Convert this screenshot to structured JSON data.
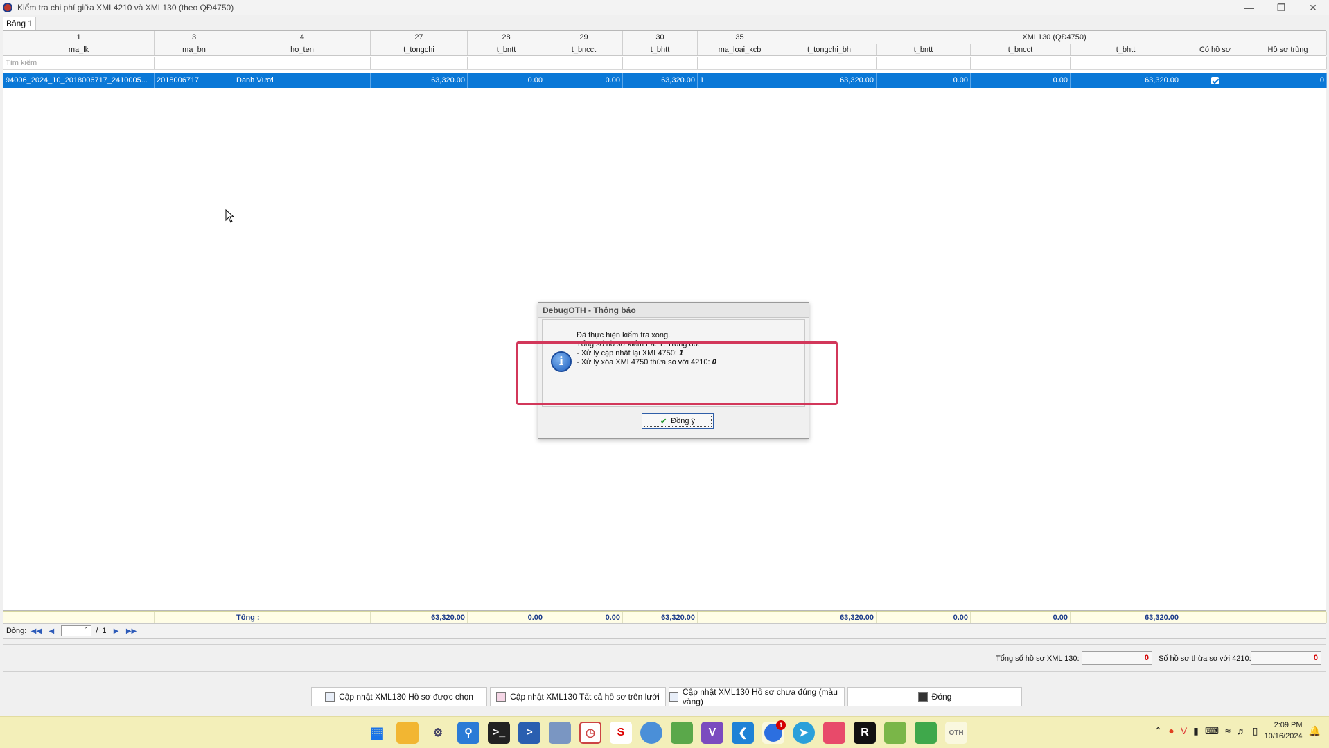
{
  "window": {
    "title": "Kiểm tra chi phí giữa XML4210 và XML130 (theo QĐ4750)",
    "tab": "Bảng 1"
  },
  "grid": {
    "group_headers": [
      "1",
      "3",
      "4",
      "27",
      "28",
      "29",
      "30",
      "35",
      "XML130 (QĐ4750)"
    ],
    "columns": [
      "ma_lk",
      "ma_bn",
      "ho_ten",
      "t_tongchi",
      "t_bntt",
      "t_bncct",
      "t_bhtt",
      "ma_loai_kcb",
      "t_tongchi_bh",
      "t_bntt",
      "t_bncct",
      "t_bhtt",
      "Có hồ sơ",
      "Hồ sơ trùng"
    ],
    "search_placeholder": "Tìm kiếm",
    "rows": [
      {
        "ma_lk": "94006_2024_10_2018006717_2410005...",
        "ma_bn": "2018006717",
        "ho_ten": "Danh Vươl",
        "t_tongchi": "63,320.00",
        "t_bntt": "0.00",
        "t_bncct": "0.00",
        "t_bhtt": "63,320.00",
        "ma_loai_kcb": "1",
        "t_tongchi_bh": "63,320.00",
        "t_bntt_130": "0.00",
        "t_bncct_130": "0.00",
        "t_bhtt_130": "63,320.00",
        "co_ho_so": true,
        "ho_so_trung": "0"
      }
    ],
    "totals": {
      "label": "Tổng :",
      "t_tongchi": "63,320.00",
      "t_bntt": "0.00",
      "t_bncct": "0.00",
      "t_bhtt": "63,320.00",
      "t_tongchi_bh": "63,320.00",
      "t_bntt_130": "0.00",
      "t_bncct_130": "0.00",
      "t_bhtt_130": "63,320.00"
    }
  },
  "navigator": {
    "label": "Dòng:",
    "current_page": "1",
    "separator": "/",
    "total_pages": "1"
  },
  "summary": {
    "total_label": "Tổng số hồ sơ XML 130:",
    "total_value": "0",
    "extra_label": "Số hồ sơ thừa so với 4210:",
    "extra_value": "0"
  },
  "buttons": {
    "update_selected": "Cập nhật XML130 Hồ sơ được chọn",
    "update_all": "Cập nhật XML130 Tất cả hồ sơ trên lưới",
    "update_incorrect": "Cập nhật XML130 Hồ sơ chưa đúng (màu vàng)",
    "close": "Đóng"
  },
  "dialog": {
    "title": "DebugOTH - Thông báo",
    "line1": "Đã thực hiện kiểm tra xong.",
    "line2": "Tổng số hồ sơ kiểm tra: 1. Trong đó:",
    "line3": "- Xử lý cập nhật lại XML4750: ",
    "line3_value": "1",
    "line4": "- Xử lý xóa XML4750 thừa so với 4210: ",
    "line4_value": "0",
    "ok_label": "Đồng ý"
  },
  "taskbar": {
    "badge_count": "1",
    "time": "2:09 PM",
    "date": "10/16/2024"
  },
  "colors": {
    "selection": "#0a78d7",
    "highlight_box": "#d2375a",
    "summary_value": "#d40000",
    "taskbar_bg": "#f3efb9"
  }
}
